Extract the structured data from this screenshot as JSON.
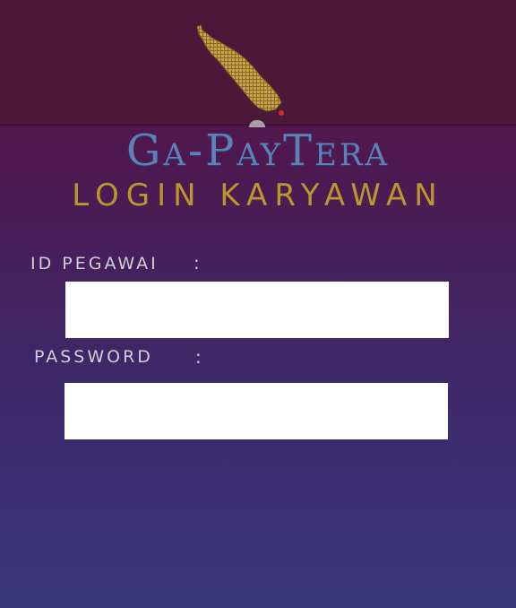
{
  "header": {
    "logo_icon": "island-map-logo-icon"
  },
  "app_title": "Ga-PayTera",
  "subtitle": "LOGIN KARYAWAN",
  "form": {
    "id_label": "ID PEGAWAI",
    "id_colon": ":",
    "id_value": "",
    "password_label": "PASSWORD",
    "password_colon": ":",
    "password_value": ""
  },
  "colors": {
    "header_bg": "#4a1838",
    "title": "#5f7fb8",
    "subtitle": "#b8972c",
    "logo_gold": "#c9a24a",
    "accent_red": "#d92a2a"
  }
}
